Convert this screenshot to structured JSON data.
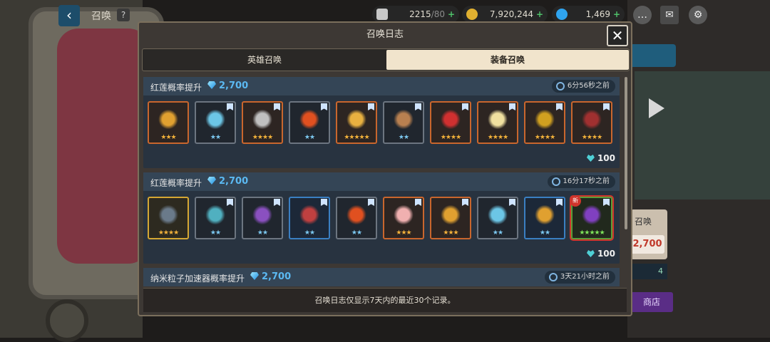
{
  "topbar": {
    "title": "召唤",
    "help": "?",
    "stamina": {
      "value": "2215",
      "max": "/80"
    },
    "gold": "7,920,244",
    "gems": "1,469",
    "plus": "+"
  },
  "background": {
    "price": "2,700",
    "card_label": "召唤",
    "bar_value": "4",
    "shop_label": "商店"
  },
  "modal": {
    "title": "召唤日志",
    "close": "✕",
    "tabs": [
      {
        "label": "英雄召唤",
        "active": false
      },
      {
        "label": "装备召唤",
        "active": true
      }
    ],
    "footer": "召唤日志仅显示7天内的最近30个记录。"
  },
  "records": [
    {
      "title": "红莲概率提升",
      "cost": "2,700",
      "time": "6分56秒之前",
      "total": "100",
      "items": [
        {
          "name": "shield-crest",
          "rarity": "orange",
          "stars": "★★★",
          "tag": false,
          "color": "#e0a030"
        },
        {
          "name": "blue-gauntlet",
          "rarity": "gray",
          "stars": "★★",
          "tag": true,
          "color": "#6cc6e6"
        },
        {
          "name": "dragon-shield",
          "rarity": "orange",
          "stars": "★★★★",
          "tag": true,
          "color": "#c0c0c0"
        },
        {
          "name": "fire-orb",
          "rarity": "gray",
          "stars": "★★",
          "tag": true,
          "color": "#e05020"
        },
        {
          "name": "golden-sword",
          "rarity": "orange",
          "stars": "★★★★★",
          "tag": true,
          "color": "#e8b040"
        },
        {
          "name": "rifle",
          "rarity": "gray",
          "stars": "★★",
          "tag": true,
          "color": "#b88050"
        },
        {
          "name": "red-blade",
          "rarity": "orange",
          "stars": "★★★★",
          "tag": true,
          "color": "#d03030"
        },
        {
          "name": "bird-charm",
          "rarity": "orange",
          "stars": "★★★★",
          "tag": true,
          "color": "#f0e0a0"
        },
        {
          "name": "gold-emblem",
          "rarity": "orange",
          "stars": "★★★★",
          "tag": true,
          "color": "#d0a020"
        },
        {
          "name": "dark-bow",
          "rarity": "orange",
          "stars": "★★★★",
          "tag": true,
          "color": "#a03030"
        }
      ]
    },
    {
      "title": "红莲概率提升",
      "cost": "2,700",
      "time": "16分17秒之前",
      "total": "100",
      "items": [
        {
          "name": "heavy-cannon",
          "rarity": "gold",
          "stars": "★★★★",
          "tag": false,
          "color": "#6a7a8a"
        },
        {
          "name": "amulet",
          "rarity": "gray",
          "stars": "★★",
          "tag": true,
          "color": "#50b0c0"
        },
        {
          "name": "purple-staff",
          "rarity": "gray",
          "stars": "★★",
          "tag": true,
          "color": "#8a50c0"
        },
        {
          "name": "red-blaster",
          "rarity": "blue",
          "stars": "★★",
          "tag": true,
          "color": "#c04040"
        },
        {
          "name": "fire-orb",
          "rarity": "gray",
          "stars": "★★",
          "tag": true,
          "color": "#e05020"
        },
        {
          "name": "pink-glove",
          "rarity": "orange",
          "stars": "★★★",
          "tag": true,
          "color": "#f0b0b0"
        },
        {
          "name": "gold-rifle",
          "rarity": "orange",
          "stars": "★★★",
          "tag": true,
          "color": "#e0a030"
        },
        {
          "name": "blue-gauntlet",
          "rarity": "gray",
          "stars": "★★",
          "tag": true,
          "color": "#6cc6e6"
        },
        {
          "name": "golden-scepter",
          "rarity": "blue",
          "stars": "★★",
          "tag": true,
          "color": "#e0a030"
        },
        {
          "name": "void-staff",
          "rarity": "green",
          "stars": "★★★★★",
          "tag": true,
          "new": true,
          "new_label": "新",
          "color": "#8040c0"
        }
      ]
    },
    {
      "title": "纳米粒子加速器概率提升",
      "cost": "2,700",
      "time": "3天21小时之前",
      "total": "",
      "items": []
    }
  ],
  "colors": {
    "star_gold": "#f2b13a",
    "star_blue": "#7cc8f0",
    "star_green": "#7ee35a",
    "gem_blue": "#5bb9f2"
  }
}
